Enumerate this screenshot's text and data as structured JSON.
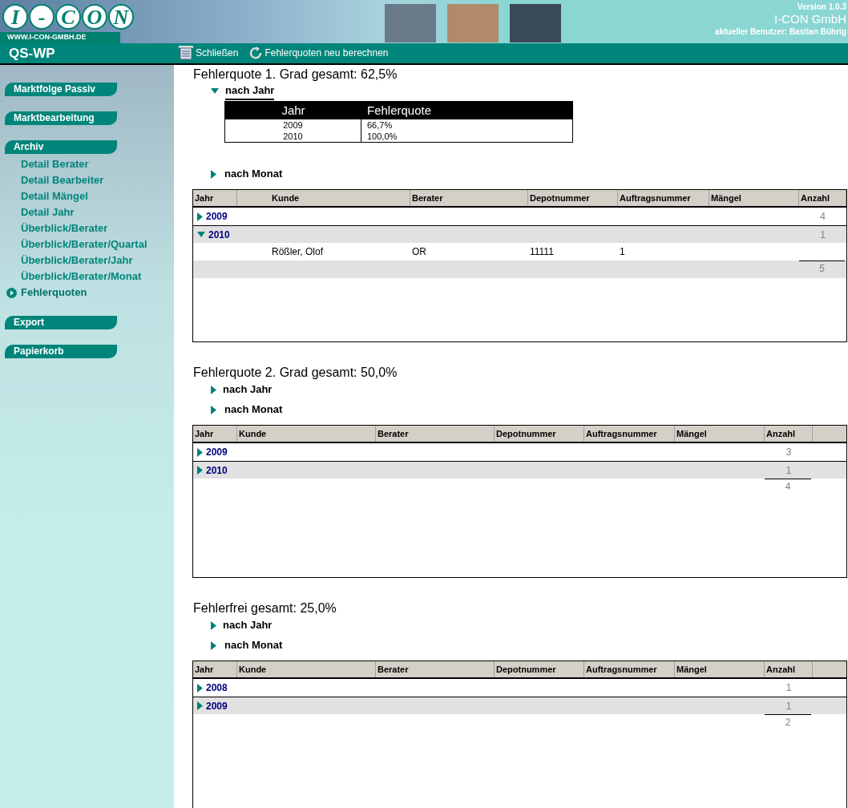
{
  "header": {
    "logo_letters": [
      "I",
      "-",
      "C",
      "O",
      "N"
    ],
    "url": "WWW.I-CON-GMBH.DE",
    "version": "Version 1.0.3",
    "company": "I-CON GmbH",
    "user": "aktueller Benutzer: Bastian Bührig"
  },
  "toolbar": {
    "app": "QS-WP",
    "buttons": [
      {
        "kind": "close",
        "label": "Schließen"
      },
      {
        "kind": "refresh",
        "label": "Fehlerquoten neu berechnen"
      }
    ]
  },
  "sidebar": [
    {
      "label": "Marktfolge Passiv"
    },
    {
      "label": "Marktbearbeitung"
    },
    {
      "label": "Archiv",
      "children": [
        {
          "label": "Detail Berater",
          "selected": false
        },
        {
          "label": "Detail Bearbeiter",
          "selected": false
        },
        {
          "label": "Detail Mängel",
          "selected": false
        },
        {
          "label": "Detail Jahr",
          "selected": false
        },
        {
          "label": "Überblick/Berater",
          "selected": false
        },
        {
          "label": "Überblick/Berater/Quartal",
          "selected": false
        },
        {
          "label": "Überblick/Berater/Jahr",
          "selected": false
        },
        {
          "label": "Überblick/Berater/Monat",
          "selected": false
        },
        {
          "label": "Fehlerquoten",
          "selected": true
        }
      ]
    },
    {
      "label": "Export"
    },
    {
      "label": "Papierkorb"
    }
  ],
  "sections": [
    {
      "title": "Fehlerquote 1. Grad gesamt: 62,5%",
      "by_year": {
        "label": "nach Jahr",
        "expanded": true,
        "columns": [
          "Jahr",
          "Fehlerquote"
        ],
        "years": [
          "2009",
          "2010"
        ],
        "rates": [
          "66,7%",
          "100,0%"
        ]
      },
      "by_month": {
        "label": "nach Monat",
        "expanded": false
      },
      "grid": {
        "columns": [
          "Jahr",
          "Kunde",
          "Berater",
          "Depotnummer",
          "Auftragsnummer",
          "Mängel",
          "Anzahl"
        ],
        "groups": [
          {
            "year": "2009",
            "expanded": false,
            "count": "4"
          },
          {
            "year": "2010",
            "expanded": true,
            "count": "1",
            "rows": [
              {
                "kunde": "Rößler, Olof",
                "berater": "OR",
                "depot": "11111",
                "auftrag": "1"
              }
            ]
          }
        ],
        "total": "5"
      }
    },
    {
      "title": "Fehlerquote 2. Grad gesamt: 50,0%",
      "by_year": {
        "label": "nach Jahr",
        "expanded": false
      },
      "by_month": {
        "label": "nach Monat",
        "expanded": false
      },
      "grid": {
        "columns": [
          "Jahr",
          "Kunde",
          "Berater",
          "Depotnummer",
          "Auftragsnummer",
          "Mängel",
          "Anzahl"
        ],
        "groups": [
          {
            "year": "2009",
            "expanded": false,
            "count": "3"
          },
          {
            "year": "2010",
            "expanded": false,
            "count": "1"
          }
        ],
        "total": "4"
      }
    },
    {
      "title": "Fehlerfrei gesamt: 25,0%",
      "by_year": {
        "label": "nach Jahr",
        "expanded": false
      },
      "by_month": {
        "label": "nach Monat",
        "expanded": false
      },
      "grid": {
        "columns": [
          "Jahr",
          "Kunde",
          "Berater",
          "Depotnummer",
          "Auftragsnummer",
          "Mängel",
          "Anzahl"
        ],
        "groups": [
          {
            "year": "2008",
            "expanded": false,
            "count": "1"
          },
          {
            "year": "2009",
            "expanded": false,
            "count": "1"
          }
        ],
        "total": "2"
      }
    }
  ]
}
